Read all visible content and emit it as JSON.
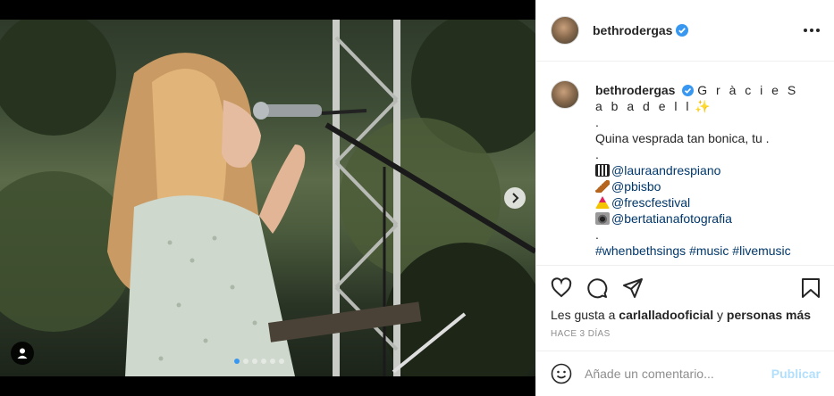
{
  "post": {
    "username": "bethrodergas",
    "caption": {
      "username": "bethrodergas",
      "title": "G r à c i e S a b a d e l l",
      "sparkle": "✨",
      "dot1": ".",
      "line1": "Quina vesprada tan bonica, tu .",
      "dot2": ".",
      "mentions": [
        "@lauraandrespiano",
        "@pbisbo",
        "@frescfestival",
        "@bertatianafotografia"
      ],
      "dot3": ".",
      "hashtags": "#whenbethsings #music #livemusic"
    },
    "likes": {
      "prefix": "Les gusta a ",
      "user": "carlalladooficial",
      "middle": " y ",
      "others": "personas más"
    },
    "time_ago": "HACE 3 DÍAS",
    "comment": {
      "placeholder": "Añade un comentario...",
      "publish_label": "Publicar"
    }
  },
  "icons": [
    "verified-icon",
    "more-options-icon",
    "heart-icon",
    "comment-icon",
    "share-icon",
    "bookmark-icon",
    "emoji-icon",
    "user-tag-icon",
    "next-arrow-icon"
  ],
  "colors": {
    "verified": "#3897f0",
    "link": "#00376b",
    "publish": "#b2dffc",
    "active_dot": "#3897f0"
  },
  "carousel": {
    "slides": 6,
    "active_slide": 1
  }
}
